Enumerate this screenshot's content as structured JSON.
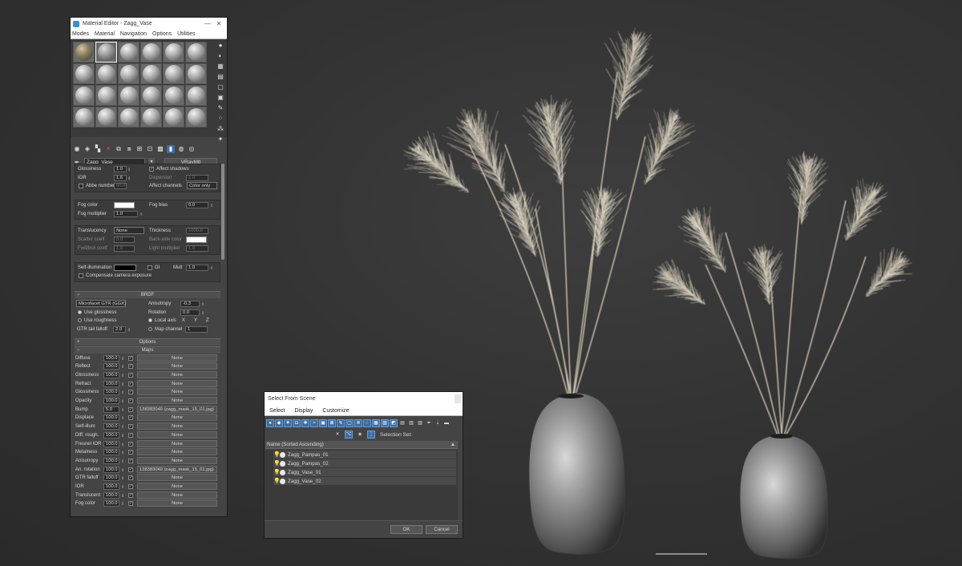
{
  "colors": {
    "viewport_bg": "#333333",
    "panel_bg": "#444444",
    "accent": "#3b6ea8"
  },
  "material_editor": {
    "title": "Material Editor - Zagg_Vase",
    "menu": [
      "Modes",
      "Material",
      "Navigation",
      "Options",
      "Utilities"
    ],
    "window_buttons": [
      "—",
      "✕"
    ],
    "material_name": "Zagg_Vase",
    "material_type": "VRayMtl",
    "reflection": {
      "glossiness_label": "Glossiness",
      "glossiness": "1.0",
      "ior_label": "IOR",
      "ior": "1.6",
      "abbe_label": "Abbe number",
      "abbe": "50.0",
      "affect_shadows_label": "Affect shadows",
      "dispersion_label": "Dispersion",
      "dispersion": "1.0",
      "affect_channels_label": "Affect channels",
      "affect_channels": "Color only"
    },
    "fog": {
      "fog_color_label": "Fog color",
      "fog_bias_label": "Fog bias",
      "fog_bias": "0.0",
      "fog_mult_label": "Fog multiplier",
      "fog_mult": "1.0"
    },
    "translucency": {
      "label": "Translucency",
      "value": "None",
      "thickness_label": "Thickness",
      "thickness": "1000.0",
      "scatter_label": "Scatter coeff",
      "scatter": "0.0",
      "backside_label": "Back-side color",
      "fwdbck_label": "Fwd/bck coeff",
      "fwdbck": "1.0",
      "light_mult_label": "Light multiplier",
      "light_mult": "1.0"
    },
    "self_illum": {
      "label": "Self-illumination",
      "gi_label": "GI",
      "mult_label": "Mult",
      "mult": "1.0",
      "comp_label": "Compensate camera exposure"
    },
    "brdf": {
      "title": "BRDF",
      "type": "Microfacet GTR (GGX)",
      "use_gloss": "Use glossiness",
      "use_rough": "Use roughness",
      "gtr_label": "GTR tail falloff",
      "gtr": "2.0",
      "aniso_label": "Anisotropy",
      "aniso": "-0.3",
      "rot_label": "Rotation",
      "rot": "0.0",
      "local_axis": "Local axis",
      "axis_x": "X",
      "axis_y": "Y",
      "axis_z": "Z",
      "map_channel": "Map channel",
      "map_channel_val": "1"
    },
    "options_title": "Options",
    "maps_title": "Maps",
    "maps": [
      {
        "name": "Diffuse",
        "amount": "100.0",
        "map": "None"
      },
      {
        "name": "Reflect",
        "amount": "100.0",
        "map": "None"
      },
      {
        "name": "Glossiness",
        "amount": "100.0",
        "map": "None"
      },
      {
        "name": "Refract",
        "amount": "100.0",
        "map": "None"
      },
      {
        "name": "Glossiness",
        "amount": "100.0",
        "map": "None"
      },
      {
        "name": "Opacity",
        "amount": "100.0",
        "map": "None"
      },
      {
        "name": "Bump",
        "amount": "5.0",
        "map": "138383040 (zagg_mask_15_01.jpg)"
      },
      {
        "name": "Displace",
        "amount": "100.0",
        "map": "None"
      },
      {
        "name": "Self-illum",
        "amount": "100.0",
        "map": "None"
      },
      {
        "name": "Diff. rough.",
        "amount": "100.0",
        "map": "None"
      },
      {
        "name": "Fresnel IOR",
        "amount": "100.0",
        "map": "None"
      },
      {
        "name": "Metalness",
        "amount": "100.0",
        "map": "None"
      },
      {
        "name": "Anisotropy",
        "amount": "100.0",
        "map": "None"
      },
      {
        "name": "An. rotation",
        "amount": "100.0",
        "map": "138383040 (zagg_mask_15_01.jpg)"
      },
      {
        "name": "GTR falloff",
        "amount": "100.0",
        "map": "None"
      },
      {
        "name": "IOR",
        "amount": "100.0",
        "map": "None"
      },
      {
        "name": "Translucent",
        "amount": "100.0",
        "map": "None"
      },
      {
        "name": "Fog color",
        "amount": "100.0",
        "map": "None"
      }
    ]
  },
  "select_from_scene": {
    "title": "Select From Scene",
    "menu": [
      "Select",
      "Display",
      "Customize"
    ],
    "selection_set_label": "Selection Set:",
    "column_header": "Name (Sorted Ascending)",
    "objects": [
      "Zagg_Pampas_01",
      "Zagg_Pampas_02",
      "Zagg_Vase_01",
      "Zagg_Vase_02"
    ],
    "ok_label": "OK",
    "cancel_label": "Cancel"
  }
}
